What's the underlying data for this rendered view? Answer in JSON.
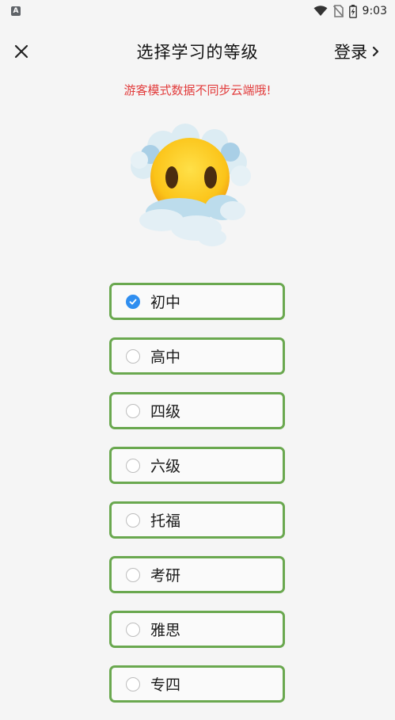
{
  "statusbar": {
    "app_icon": "A",
    "time": "9:03",
    "icons": [
      "wifi-icon",
      "no-sim-icon",
      "battery-charging-icon"
    ]
  },
  "header": {
    "title": "选择学习的等级",
    "login_label": "登录",
    "close_icon": "close-icon",
    "chevron_icon": "chevron-right-icon"
  },
  "warning": "游客模式数据不同步云端哦!",
  "colors": {
    "accent_green": "#6aa84f",
    "checked_blue": "#2f8ef0",
    "warning_red": "#e23c3c"
  },
  "options": [
    {
      "label": "初中",
      "checked": true
    },
    {
      "label": "高中",
      "checked": false
    },
    {
      "label": "四级",
      "checked": false
    },
    {
      "label": "六级",
      "checked": false
    },
    {
      "label": "托福",
      "checked": false
    },
    {
      "label": "考研",
      "checked": false
    },
    {
      "label": "雅思",
      "checked": false
    },
    {
      "label": "专四",
      "checked": false
    }
  ]
}
